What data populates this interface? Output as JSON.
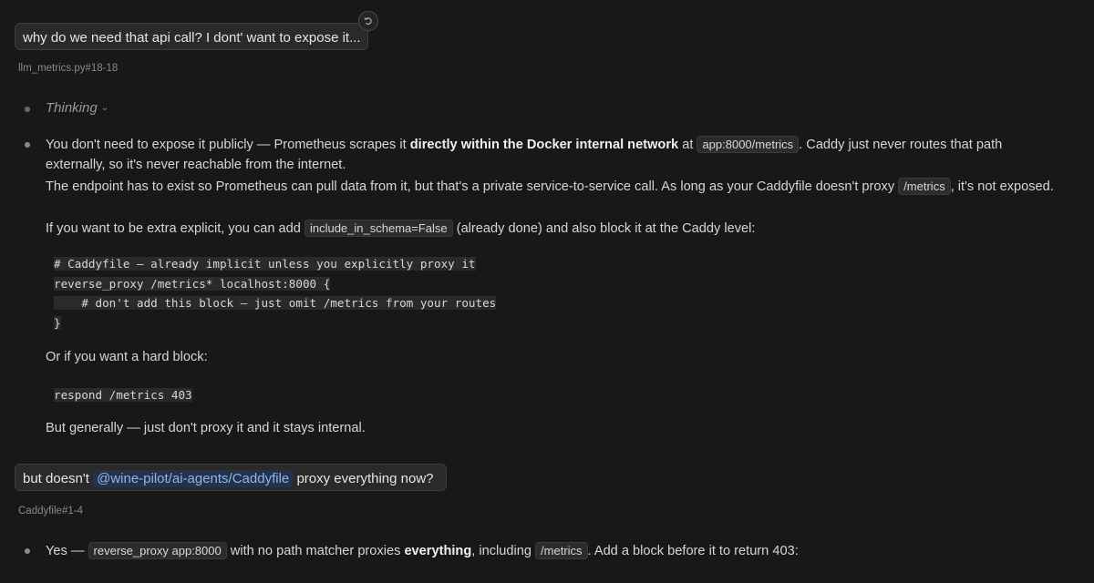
{
  "messages": {
    "first_user": "why do we need that api call? I dont' want to expose it...",
    "first_ref": "llm_metrics.py#18-18",
    "second_user_prefix": "but doesn't",
    "second_user_mention": "@wine-pilot/ai-agents/Caddyfile",
    "second_user_suffix": "proxy everything now?",
    "second_ref": "Caddyfile#1-4"
  },
  "assistant1": {
    "thinking_label": "Thinking",
    "p1_a": "You don't need to expose it publicly — Prometheus scrapes it",
    "p1_bold": "directly within the Docker internal network",
    "p1_b": "at",
    "p1_code": "app:8000/metrics",
    "p1_c": ". Caddy just never routes that path externally, so it's never reachable from the internet.",
    "p2_a": "The endpoint has to exist so Prometheus can pull data from it, but that's a private service-to-service call. As long as your Caddyfile doesn't proxy",
    "p2_code": "/metrics",
    "p2_b": ", it's not exposed.",
    "p3_a": "If you want to be extra explicit, you can add",
    "p3_code": "include_in_schema=False",
    "p3_b": "(already done) and also block it at the Caddy level:",
    "code1": [
      "# Caddyfile — already implicit unless you explicitly proxy it",
      "reverse_proxy /metrics* localhost:8000 {",
      "    # don't add this block — just omit /metrics from your routes",
      "}"
    ],
    "p4": "Or if you want a hard block:",
    "code2": [
      "respond /metrics 403"
    ],
    "p5": "But generally — just don't proxy it and it stays internal."
  },
  "assistant2": {
    "p1_a": "Yes —",
    "p1_code": "reverse_proxy app:8000",
    "p1_b": "with no path matcher proxies",
    "p1_bold": "everything",
    "p1_c": ", including",
    "p1_code2": "/metrics",
    "p1_d": ". Add a block before it to return 403:"
  },
  "icons": {
    "revert": "revert-icon",
    "chevron": "chevron-down-icon",
    "bullet": "bullet-dot"
  }
}
